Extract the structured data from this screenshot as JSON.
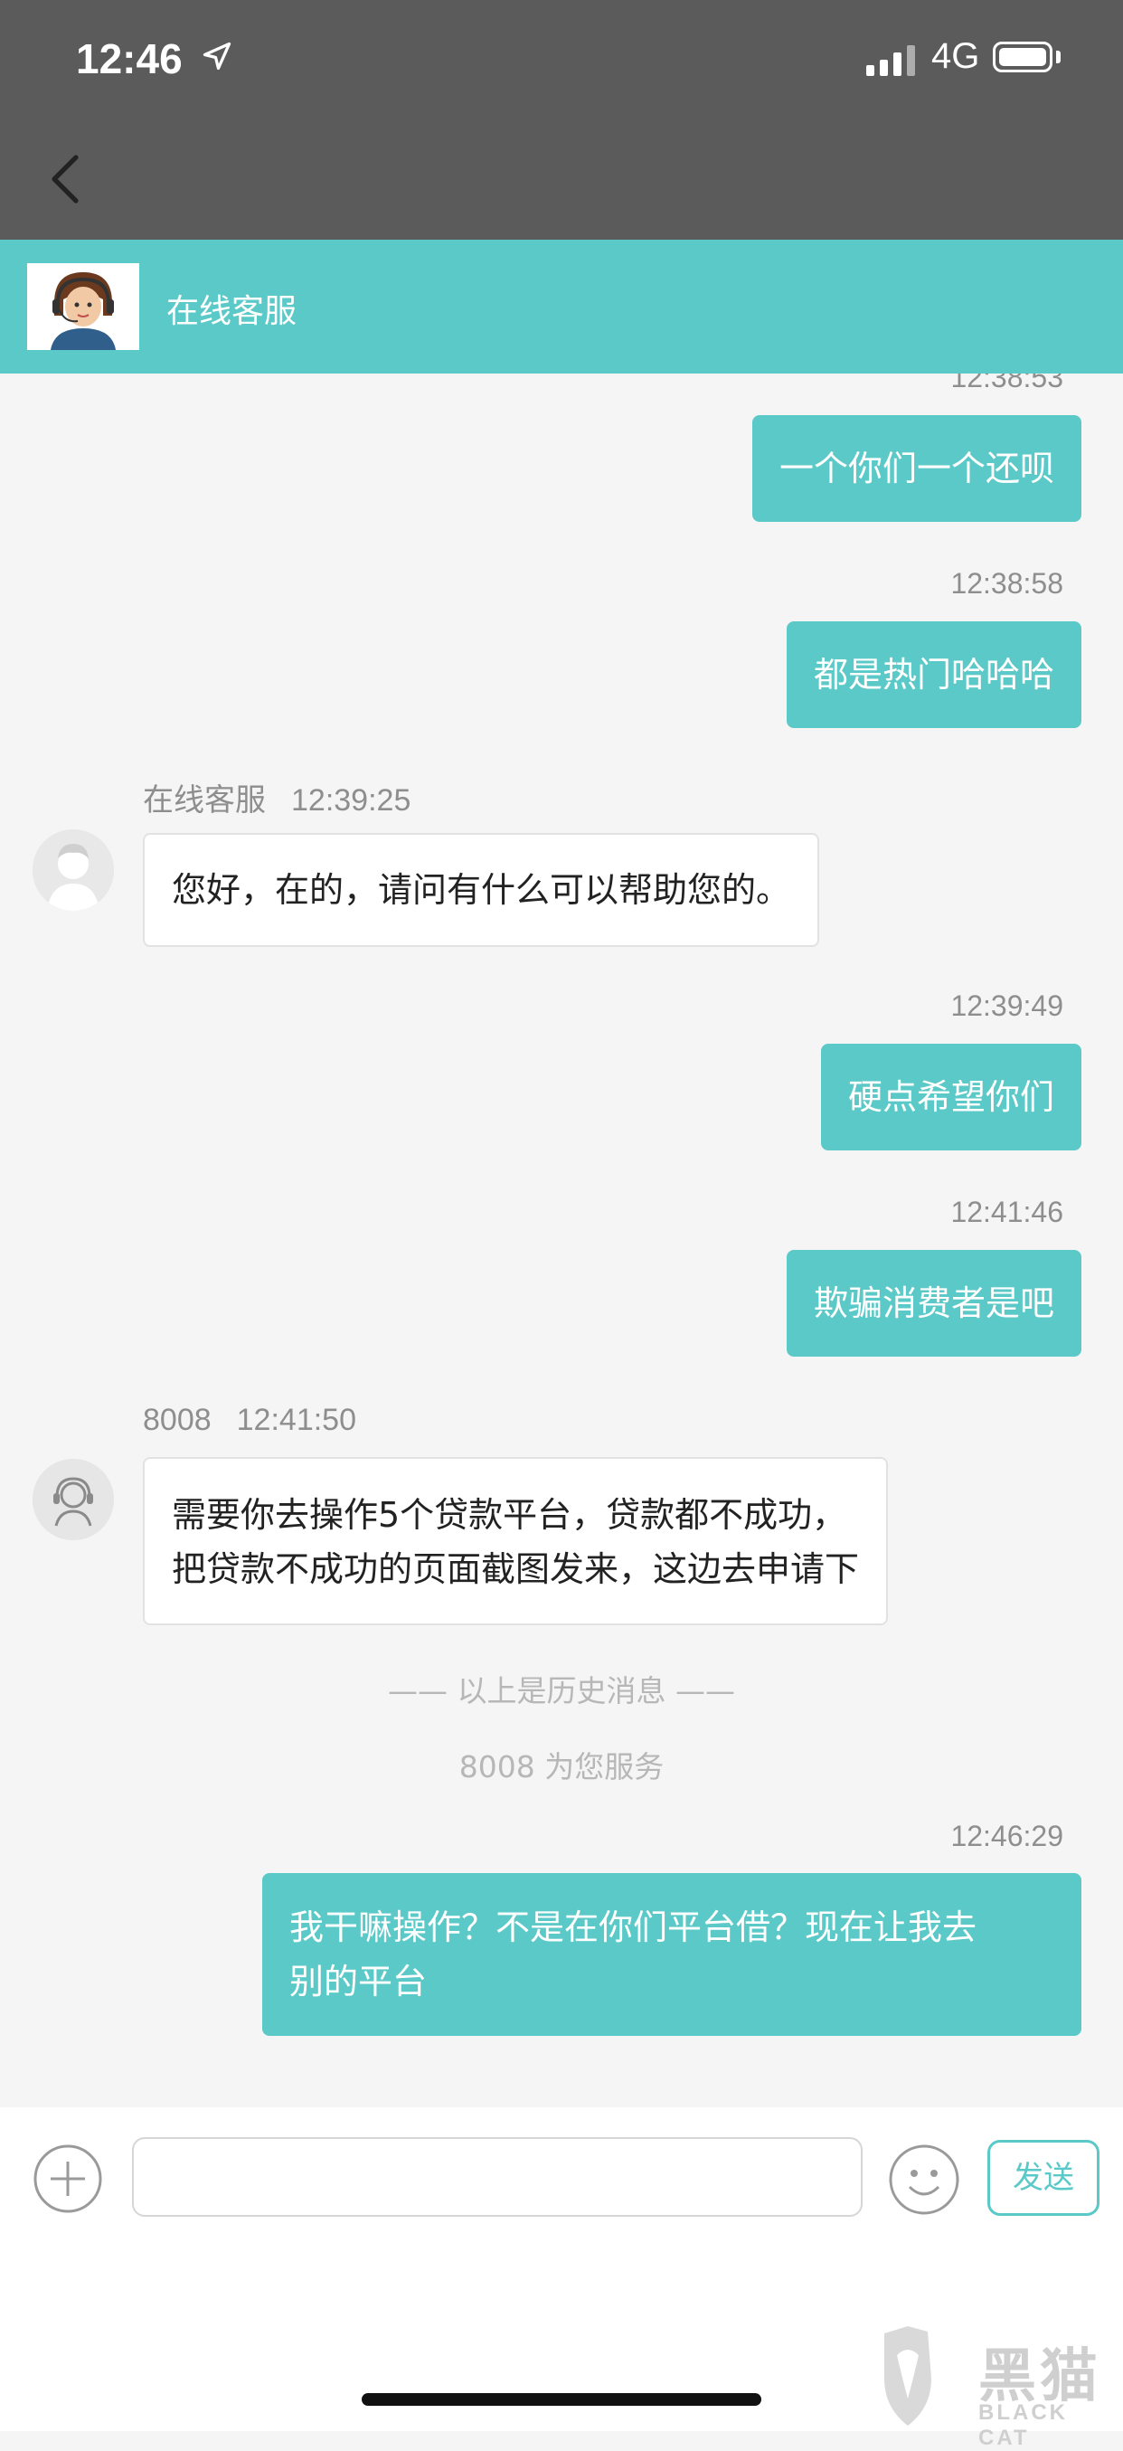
{
  "status_bar": {
    "time": "12:46",
    "network": "4G"
  },
  "header": {
    "title": "在线客服"
  },
  "messages": {
    "m1": {
      "time": "12:38:53",
      "text": "一个你们一个还呗"
    },
    "m2": {
      "time": "12:38:58",
      "text": "都是热门哈哈哈"
    },
    "m3": {
      "sender": "在线客服",
      "time": "12:39:25",
      "text": "您好，在的，请问有什么可以帮助您的。"
    },
    "m4": {
      "time": "12:39:49",
      "text": "硬点希望你们"
    },
    "m5": {
      "time": "12:41:46",
      "text": "欺骗消费者是吧"
    },
    "m6": {
      "sender": "8008",
      "time": "12:41:50",
      "line1": "需要你去操作5个贷款平台，贷款都不成功，",
      "line2": "把贷款不成功的页面截图发来，这边去申请下"
    },
    "history_divider": "—— 以上是历史消息 ——",
    "service_notice": "8008 为您服务",
    "m7": {
      "time": "12:46:29",
      "line1": "我干嘛操作？不是在你们平台借？现在让我去",
      "line2": "别的平台"
    }
  },
  "input_bar": {
    "placeholder": "",
    "send_label": "发送"
  },
  "watermark": {
    "title": "黑猫",
    "subtitle": "BLACK CAT"
  },
  "colors": {
    "accent": "#5bc9c7",
    "topbar": "#5b5b5b",
    "background": "#f5f5f5"
  }
}
